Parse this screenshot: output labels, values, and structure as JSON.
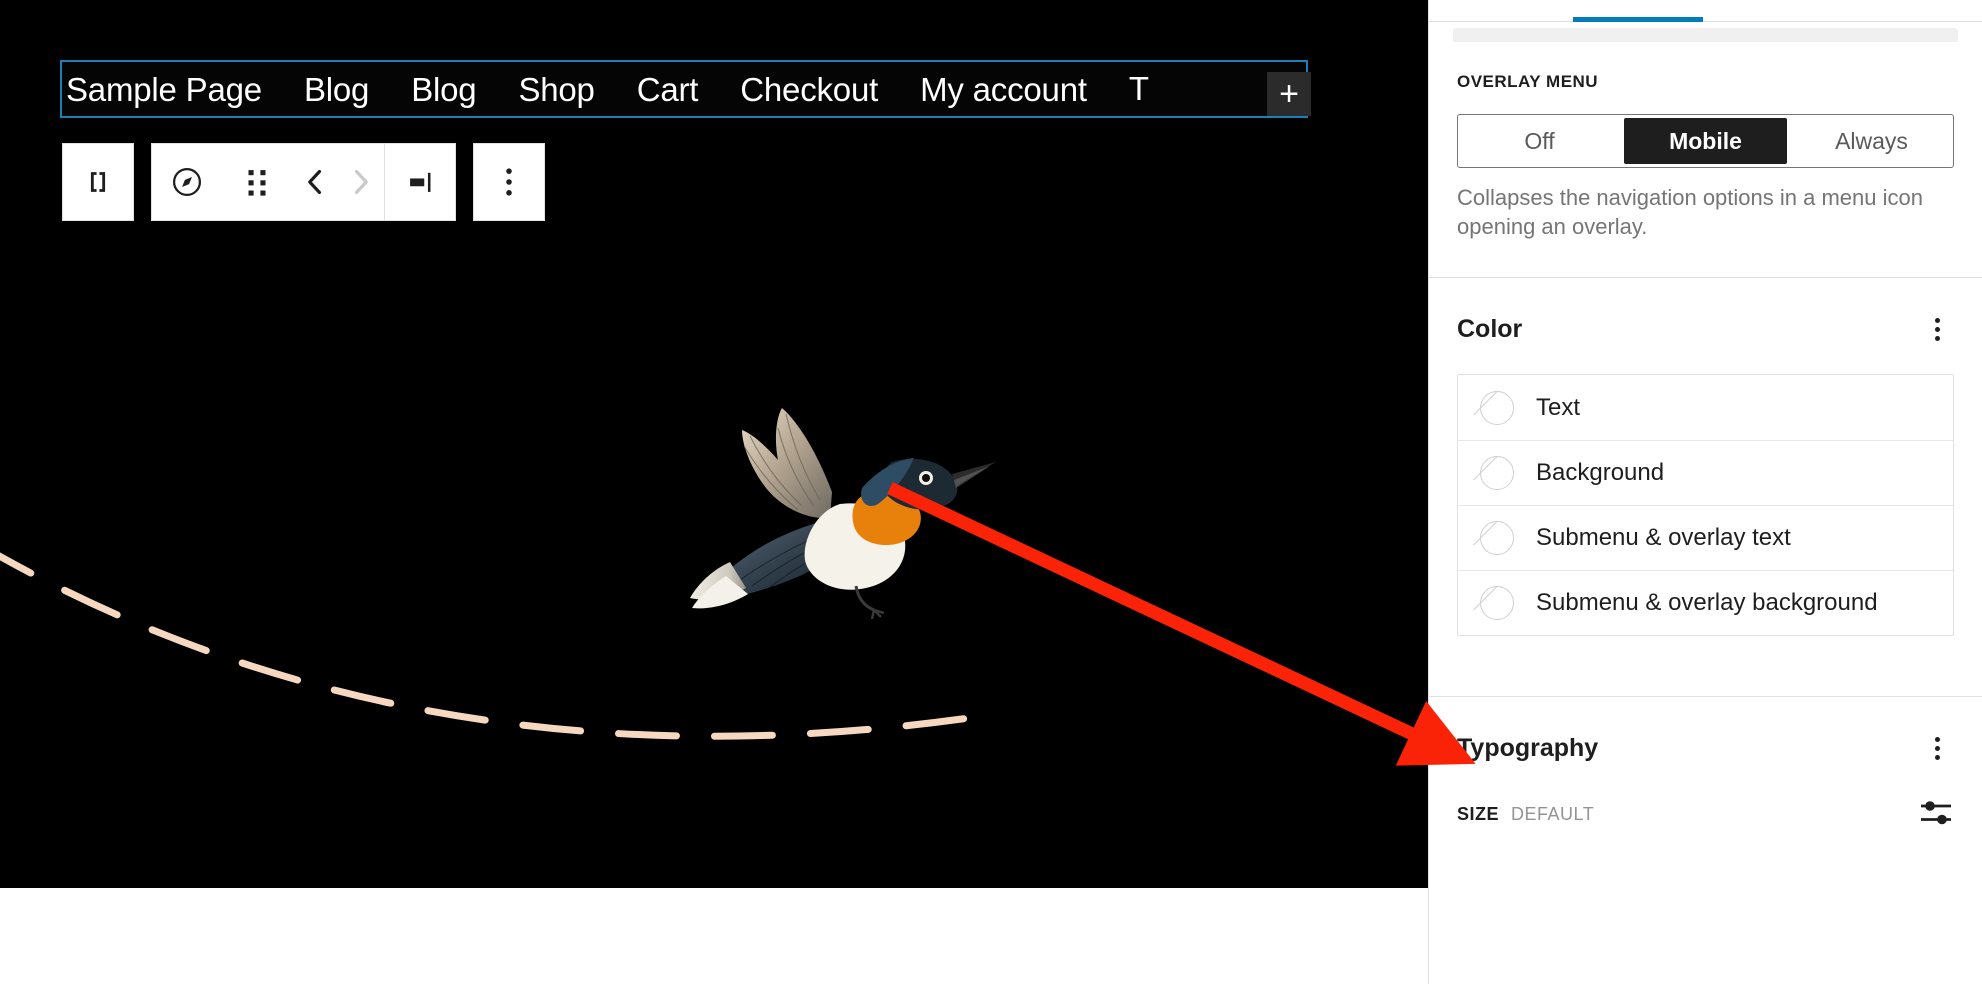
{
  "canvas": {
    "navigation_block": {
      "items": [
        {
          "label": "Sample Page"
        },
        {
          "label": "Blog"
        },
        {
          "label": "Blog"
        },
        {
          "label": "Shop"
        },
        {
          "label": "Cart"
        },
        {
          "label": "Checkout"
        },
        {
          "label": "My account"
        }
      ],
      "truncated_item": "T",
      "appender_label": "+",
      "selection_color": "#1a7fbb"
    },
    "toolbar": {
      "buttons": [
        {
          "name": "block-type-navigation",
          "icon": "navigation-block-icon",
          "title": "Navigation"
        },
        {
          "name": "select-parent",
          "icon": "compass-icon",
          "title": "Select parent block"
        },
        {
          "name": "drag-handle",
          "icon": "drag-handle-icon",
          "title": "Drag"
        },
        {
          "name": "move-up",
          "icon": "chevron-left-icon",
          "title": "Move left"
        },
        {
          "name": "move-down",
          "icon": "chevron-right-icon",
          "title": "Move right"
        },
        {
          "name": "justify-items",
          "icon": "justify-right-icon",
          "title": "Justification"
        },
        {
          "name": "more-options",
          "icon": "kebab-icon",
          "title": "Options"
        }
      ]
    },
    "background_color": "#000000",
    "accent_curve_color": "#f6d7c0",
    "annotation_arrow_color": "#fa2307"
  },
  "sidebar": {
    "active_tab_accent": "#007cba",
    "overlay_menu": {
      "label": "OVERLAY MENU",
      "options": [
        {
          "label": "Off",
          "selected": false
        },
        {
          "label": "Mobile",
          "selected": true
        },
        {
          "label": "Always",
          "selected": false
        }
      ],
      "help_text": "Collapses the navigation options in a menu icon opening an overlay."
    },
    "color_panel": {
      "title": "Color",
      "options_icon": "kebab-icon",
      "rows": [
        {
          "label": "Text",
          "swatch": "none"
        },
        {
          "label": "Background",
          "swatch": "none"
        },
        {
          "label": "Submenu & overlay text",
          "swatch": "none"
        },
        {
          "label": "Submenu & overlay background",
          "swatch": "none"
        }
      ]
    },
    "typography_panel": {
      "title": "Typography",
      "options_icon": "kebab-icon",
      "size": {
        "key": "SIZE",
        "value": "DEFAULT",
        "control_icon": "settings-slider-icon"
      }
    }
  }
}
